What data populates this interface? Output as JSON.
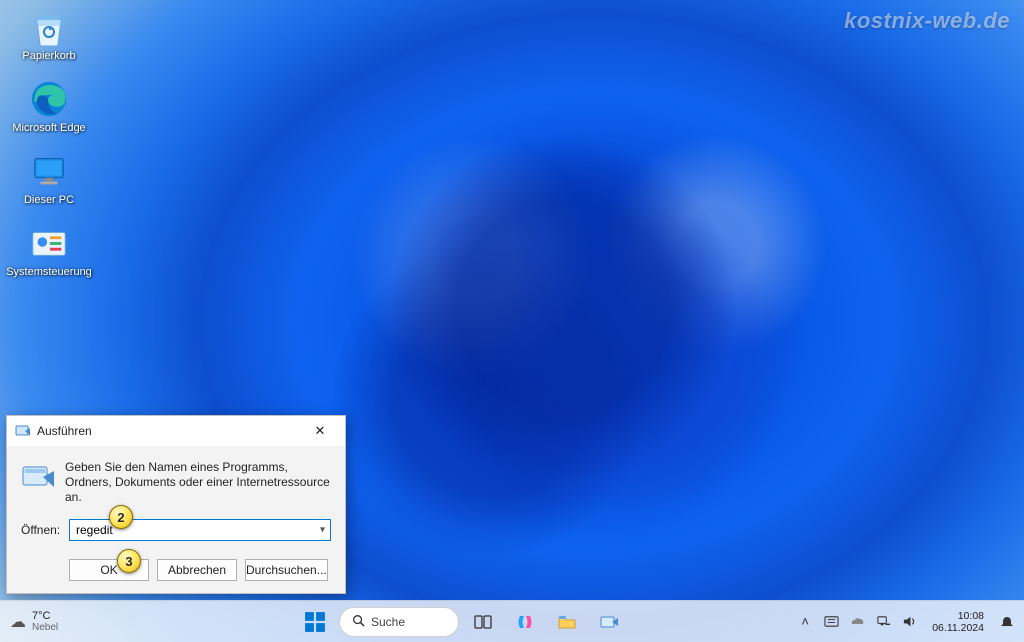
{
  "watermark": "kostnix-web.de",
  "desktop_icons": [
    {
      "id": "recycle-bin",
      "label": "Papierkorb"
    },
    {
      "id": "edge",
      "label": "Microsoft Edge"
    },
    {
      "id": "this-pc",
      "label": "Dieser PC"
    },
    {
      "id": "control-panel",
      "label": "Systemsteuerung"
    }
  ],
  "run_dialog": {
    "title": "Ausführen",
    "description": "Geben Sie den Namen eines Programms, Ordners, Dokuments oder einer Internetressource an.",
    "open_label": "Öffnen:",
    "input_value": "regedit",
    "buttons": {
      "ok": "OK",
      "cancel": "Abbrechen",
      "browse": "Durchsuchen..."
    }
  },
  "callouts": {
    "input": "2",
    "ok": "3"
  },
  "taskbar": {
    "weather": {
      "temp": "7°C",
      "condition": "Nebel"
    },
    "search_placeholder": "Suche",
    "clock": {
      "time": "10:08",
      "date": "06.11.2024"
    }
  }
}
